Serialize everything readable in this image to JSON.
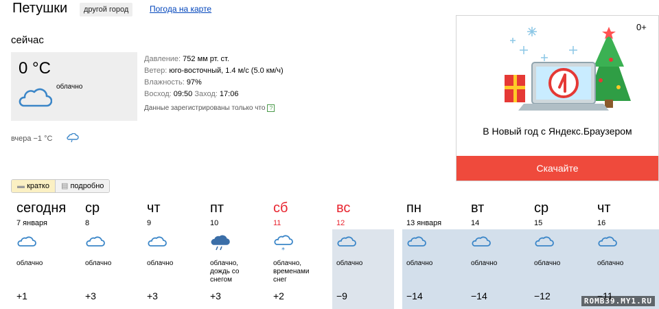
{
  "header": {
    "city": "Петушки",
    "other_city": "другой город",
    "map_link": "Погода на карте"
  },
  "now": {
    "label": "сейчас",
    "temp": "0 °C",
    "condition": "облачно",
    "icon": "cloud-icon",
    "pressure_k": "Давление:",
    "pressure_v": "752 мм рт. ст.",
    "wind_k": "Ветер:",
    "wind_v": "юго-восточный, 1.4 м/с (5.0 км/ч)",
    "humidity_k": "Влажность:",
    "humidity_v": "97%",
    "sunrise_k": "Восход:",
    "sunrise_v": "09:50",
    "sunset_k": "Заход:",
    "sunset_v": "17:06",
    "note": "Данные зарегистрированы только что",
    "note_q": "?",
    "yesterday": "вчера −1 °C"
  },
  "ad": {
    "age": "0+",
    "text": "В Новый год с Яндекс.Браузером",
    "button": "Скачайте"
  },
  "toggle": {
    "short": "кратко",
    "detailed": "подробно"
  },
  "forecast": [
    {
      "day": "сегодня",
      "date": "7 января",
      "cond": "облачно",
      "temp": "+1",
      "icon": "cloud-icon",
      "weekend": false
    },
    {
      "day": "ср",
      "date": "8",
      "cond": "облачно",
      "temp": "+3",
      "icon": "cloud-icon",
      "weekend": false
    },
    {
      "day": "чт",
      "date": "9",
      "cond": "облачно",
      "temp": "+3",
      "icon": "cloud-icon",
      "weekend": false
    },
    {
      "day": "пт",
      "date": "10",
      "cond": "облачно,\nдождь со\nснегом",
      "temp": "+3",
      "icon": "cloud-rain-snow-icon",
      "weekend": false
    },
    {
      "day": "сб",
      "date": "11",
      "cond": "облачно,\nвременами\nснег",
      "temp": "+2",
      "icon": "cloud-snow-icon",
      "weekend": true
    },
    {
      "day": "вс",
      "date": "12",
      "cond": "облачно",
      "temp": "−9",
      "icon": "cloud-icon",
      "weekend": true
    },
    {
      "day": "пн",
      "date": "13 января",
      "cond": "облачно",
      "temp": "−14",
      "icon": "cloud-icon",
      "weekend": false
    },
    {
      "day": "вт",
      "date": "14",
      "cond": "облачно",
      "temp": "−14",
      "icon": "cloud-icon",
      "weekend": false
    },
    {
      "day": "ср",
      "date": "15",
      "cond": "облачно",
      "temp": "−12",
      "icon": "cloud-icon",
      "weekend": false
    },
    {
      "day": "чт",
      "date": "16",
      "cond": "облачно",
      "temp": "−11",
      "icon": "cloud-icon",
      "weekend": false
    }
  ],
  "watermark": "ROMB39.MY1.RU",
  "colors": {
    "accent_red": "#e8232e",
    "link_blue": "#0044bb",
    "icon_blue": "#3b86c8",
    "ad_button": "#ef4a3c"
  }
}
